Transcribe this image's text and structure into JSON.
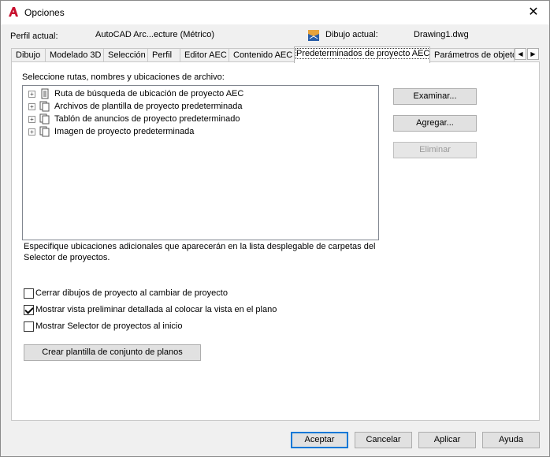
{
  "window": {
    "title": "Opciones",
    "close_glyph": "✕"
  },
  "profile": {
    "label": "Perfil actual:",
    "value": "AutoCAD Arc...ecture (Métrico)",
    "drawing_label": "Dibujo actual:",
    "drawing_value": "Drawing1.dwg"
  },
  "tabs": [
    {
      "label": "Dibujo"
    },
    {
      "label": "Modelado 3D"
    },
    {
      "label": "Selección"
    },
    {
      "label": "Perfil"
    },
    {
      "label": "Editor AEC"
    },
    {
      "label": "Contenido AEC"
    },
    {
      "label": "Predeterminados de proyecto AEC",
      "active": true
    },
    {
      "label": "Parámetros de objeto"
    }
  ],
  "tab_scroll": {
    "left": "◀",
    "right": "▶"
  },
  "section": {
    "label": "Seleccione rutas, nombres y ubicaciones de archivo:"
  },
  "tree": {
    "items": [
      {
        "label": "Ruta de búsqueda de ubicación de proyecto AEC",
        "expander": "+"
      },
      {
        "label": "Archivos de plantilla de proyecto predeterminada",
        "expander": "+"
      },
      {
        "label": "Tablón de anuncios de proyecto predeterminado",
        "expander": "+"
      },
      {
        "label": "Imagen de proyecto predeterminada",
        "expander": "+"
      }
    ]
  },
  "description": "Especifique ubicaciones adicionales que aparecerán en la lista desplegable de carpetas del Selector de proyectos.",
  "side_buttons": {
    "browse": "Examinar...",
    "add": "Agregar...",
    "remove": "Eliminar"
  },
  "checkboxes": [
    {
      "label": "Cerrar dibujos de proyecto al cambiar de proyecto",
      "checked": false
    },
    {
      "label": "Mostrar vista preliminar detallada al colocar la vista en el plano",
      "checked": true
    },
    {
      "label": "Mostrar Selector de proyectos al inicio",
      "checked": false
    }
  ],
  "template_button": "Crear plantilla de conjunto de planos",
  "footer": {
    "ok": "Aceptar",
    "cancel": "Cancelar",
    "apply": "Aplicar",
    "help": "Ayuda"
  },
  "colors": {
    "accent": "#0078d7",
    "brand_red": "#c8102e"
  }
}
